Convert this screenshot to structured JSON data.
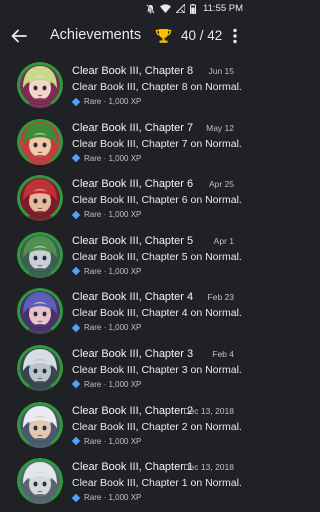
{
  "status_bar": {
    "time": "11:55 PM"
  },
  "header": {
    "title": "Achievements",
    "count": "40 / 42"
  },
  "colors": {
    "background": "#202124",
    "rare_diamond": "#4fa3ff",
    "trophy": "#fbbc05",
    "avatar_ring": "#2e9a3e"
  },
  "achievements": [
    {
      "title": "Clear Book III, Chapter 8",
      "date": "Jun 15",
      "description": "Clear Book III, Chapter 8 on Normal.",
      "rarity": "Rare",
      "xp": "1,000 XP",
      "avatar_icon": "blonde-girl-portrait-icon",
      "hair": "#c9d98a",
      "skin": "#f1d6c8",
      "bg": "#7e2a55"
    },
    {
      "title": "Clear Book III, Chapter 7",
      "date": "May 12",
      "description": "Clear Book III, Chapter 7 on Normal.",
      "rarity": "Rare",
      "xp": "1,000 XP",
      "avatar_icon": "golden-armored-girl-portrait-icon",
      "hair": "#3f8a3a",
      "skin": "#f0c9a8",
      "bg": "#c23d3d"
    },
    {
      "title": "Clear Book III, Chapter 6",
      "date": "Apr 25",
      "description": "Clear Book III, Chapter 6 on Normal.",
      "rarity": "Rare",
      "xp": "1,000 XP",
      "avatar_icon": "red-haired-warrior-portrait-icon",
      "hair": "#c23037",
      "skin": "#e8b89a",
      "bg": "#7a1d2a"
    },
    {
      "title": "Clear Book III, Chapter 5",
      "date": "Apr 1",
      "description": "Clear Book III, Chapter 5 on Normal.",
      "rarity": "Rare",
      "xp": "1,000 XP",
      "avatar_icon": "green-haired-knight-portrait-icon",
      "hair": "#4f8f4f",
      "skin": "#c9cfd6",
      "bg": "#3d5e52"
    },
    {
      "title": "Clear Book III, Chapter 4",
      "date": "Feb 23",
      "description": "Clear Book III, Chapter 4 on Normal.",
      "rarity": "Rare",
      "xp": "1,000 XP",
      "avatar_icon": "blue-haired-mage-portrait-icon",
      "hair": "#5a5fb8",
      "skin": "#e6c2c9",
      "bg": "#4a2f6a"
    },
    {
      "title": "Clear Book III, Chapter 3",
      "date": "Feb 4",
      "description": "Clear Book III, Chapter 3 on Normal.",
      "rarity": "Rare",
      "xp": "1,000 XP",
      "avatar_icon": "pale-sorceress-portrait-icon",
      "hair": "#d7dde2",
      "skin": "#b9c4cc",
      "bg": "#3a4550"
    },
    {
      "title": "Clear Book III, Chapter 2",
      "date": "Dec 13, 2018",
      "description": "Clear Book III, Chapter 2 on Normal.",
      "rarity": "Rare",
      "xp": "1,000 XP",
      "avatar_icon": "white-haired-prince-portrait-icon",
      "hair": "#e8ecef",
      "skin": "#e3c7b0",
      "bg": "#4b5a6a"
    },
    {
      "title": "Clear Book III, Chapter 1",
      "date": "Dec 13, 2018",
      "description": "Clear Book III, Chapter 1 on Normal.",
      "rarity": "Rare",
      "xp": "1,000 XP",
      "avatar_icon": "silver-masked-figure-portrait-icon",
      "hair": "#e3e7ea",
      "skin": "#d6d9dc",
      "bg": "#5a6470"
    }
  ]
}
